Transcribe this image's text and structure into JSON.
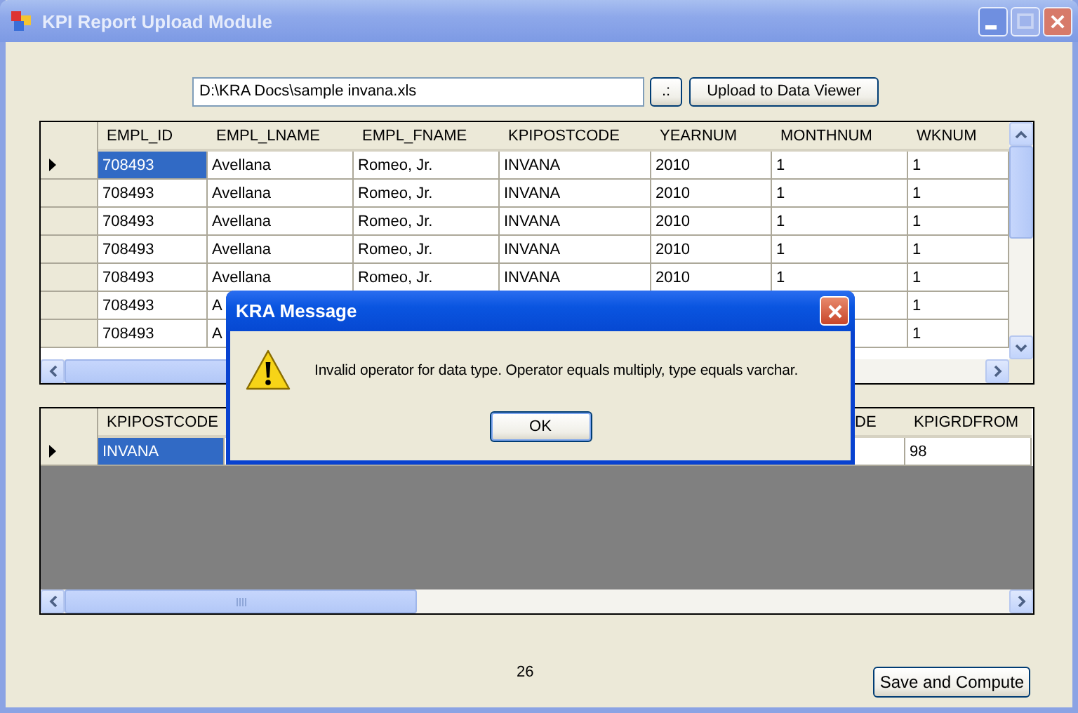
{
  "window": {
    "title": "KPI Report Upload Module"
  },
  "file_path": {
    "value": "D:\\KRA Docs\\sample invana.xls"
  },
  "browse_button": ".:",
  "upload_button": "Upload to Data Viewer",
  "employee_grid": {
    "columns": [
      "EMPL_ID",
      "EMPL_LNAME",
      "EMPL_FNAME",
      "KPIPOSTCODE",
      "YEARNUM",
      "MONTHNUM",
      "WKNUM"
    ],
    "rows": [
      {
        "selected": true,
        "cells": [
          "708493",
          "Avellana",
          "Romeo, Jr.",
          "INVANA",
          "2010",
          "1",
          "1"
        ]
      },
      {
        "selected": false,
        "cells": [
          "708493",
          "Avellana",
          "Romeo, Jr.",
          "INVANA",
          "2010",
          "1",
          "1"
        ]
      },
      {
        "selected": false,
        "cells": [
          "708493",
          "Avellana",
          "Romeo, Jr.",
          "INVANA",
          "2010",
          "1",
          "1"
        ]
      },
      {
        "selected": false,
        "cells": [
          "708493",
          "Avellana",
          "Romeo, Jr.",
          "INVANA",
          "2010",
          "1",
          "1"
        ]
      },
      {
        "selected": false,
        "cells": [
          "708493",
          "Avellana",
          "Romeo, Jr.",
          "INVANA",
          "2010",
          "1",
          "1"
        ]
      },
      {
        "selected": false,
        "cells": [
          "708493",
          "A",
          null,
          null,
          null,
          null,
          "1"
        ]
      },
      {
        "selected": false,
        "cells": [
          "708493",
          "A",
          null,
          null,
          null,
          null,
          "1"
        ]
      }
    ]
  },
  "kpi_grid": {
    "columns": [
      "KPIPOSTCODE",
      null,
      "DE",
      "KPIGRDFROM"
    ],
    "rows": [
      {
        "selected": true,
        "cells": [
          "INVANA",
          null,
          null,
          "98"
        ]
      }
    ]
  },
  "count_label": "26",
  "save_button": "Save and Compute",
  "dialog": {
    "title": "KRA Message",
    "message": "Invalid operator for data type. Operator equals multiply, type equals varchar.",
    "ok_button": "OK"
  }
}
